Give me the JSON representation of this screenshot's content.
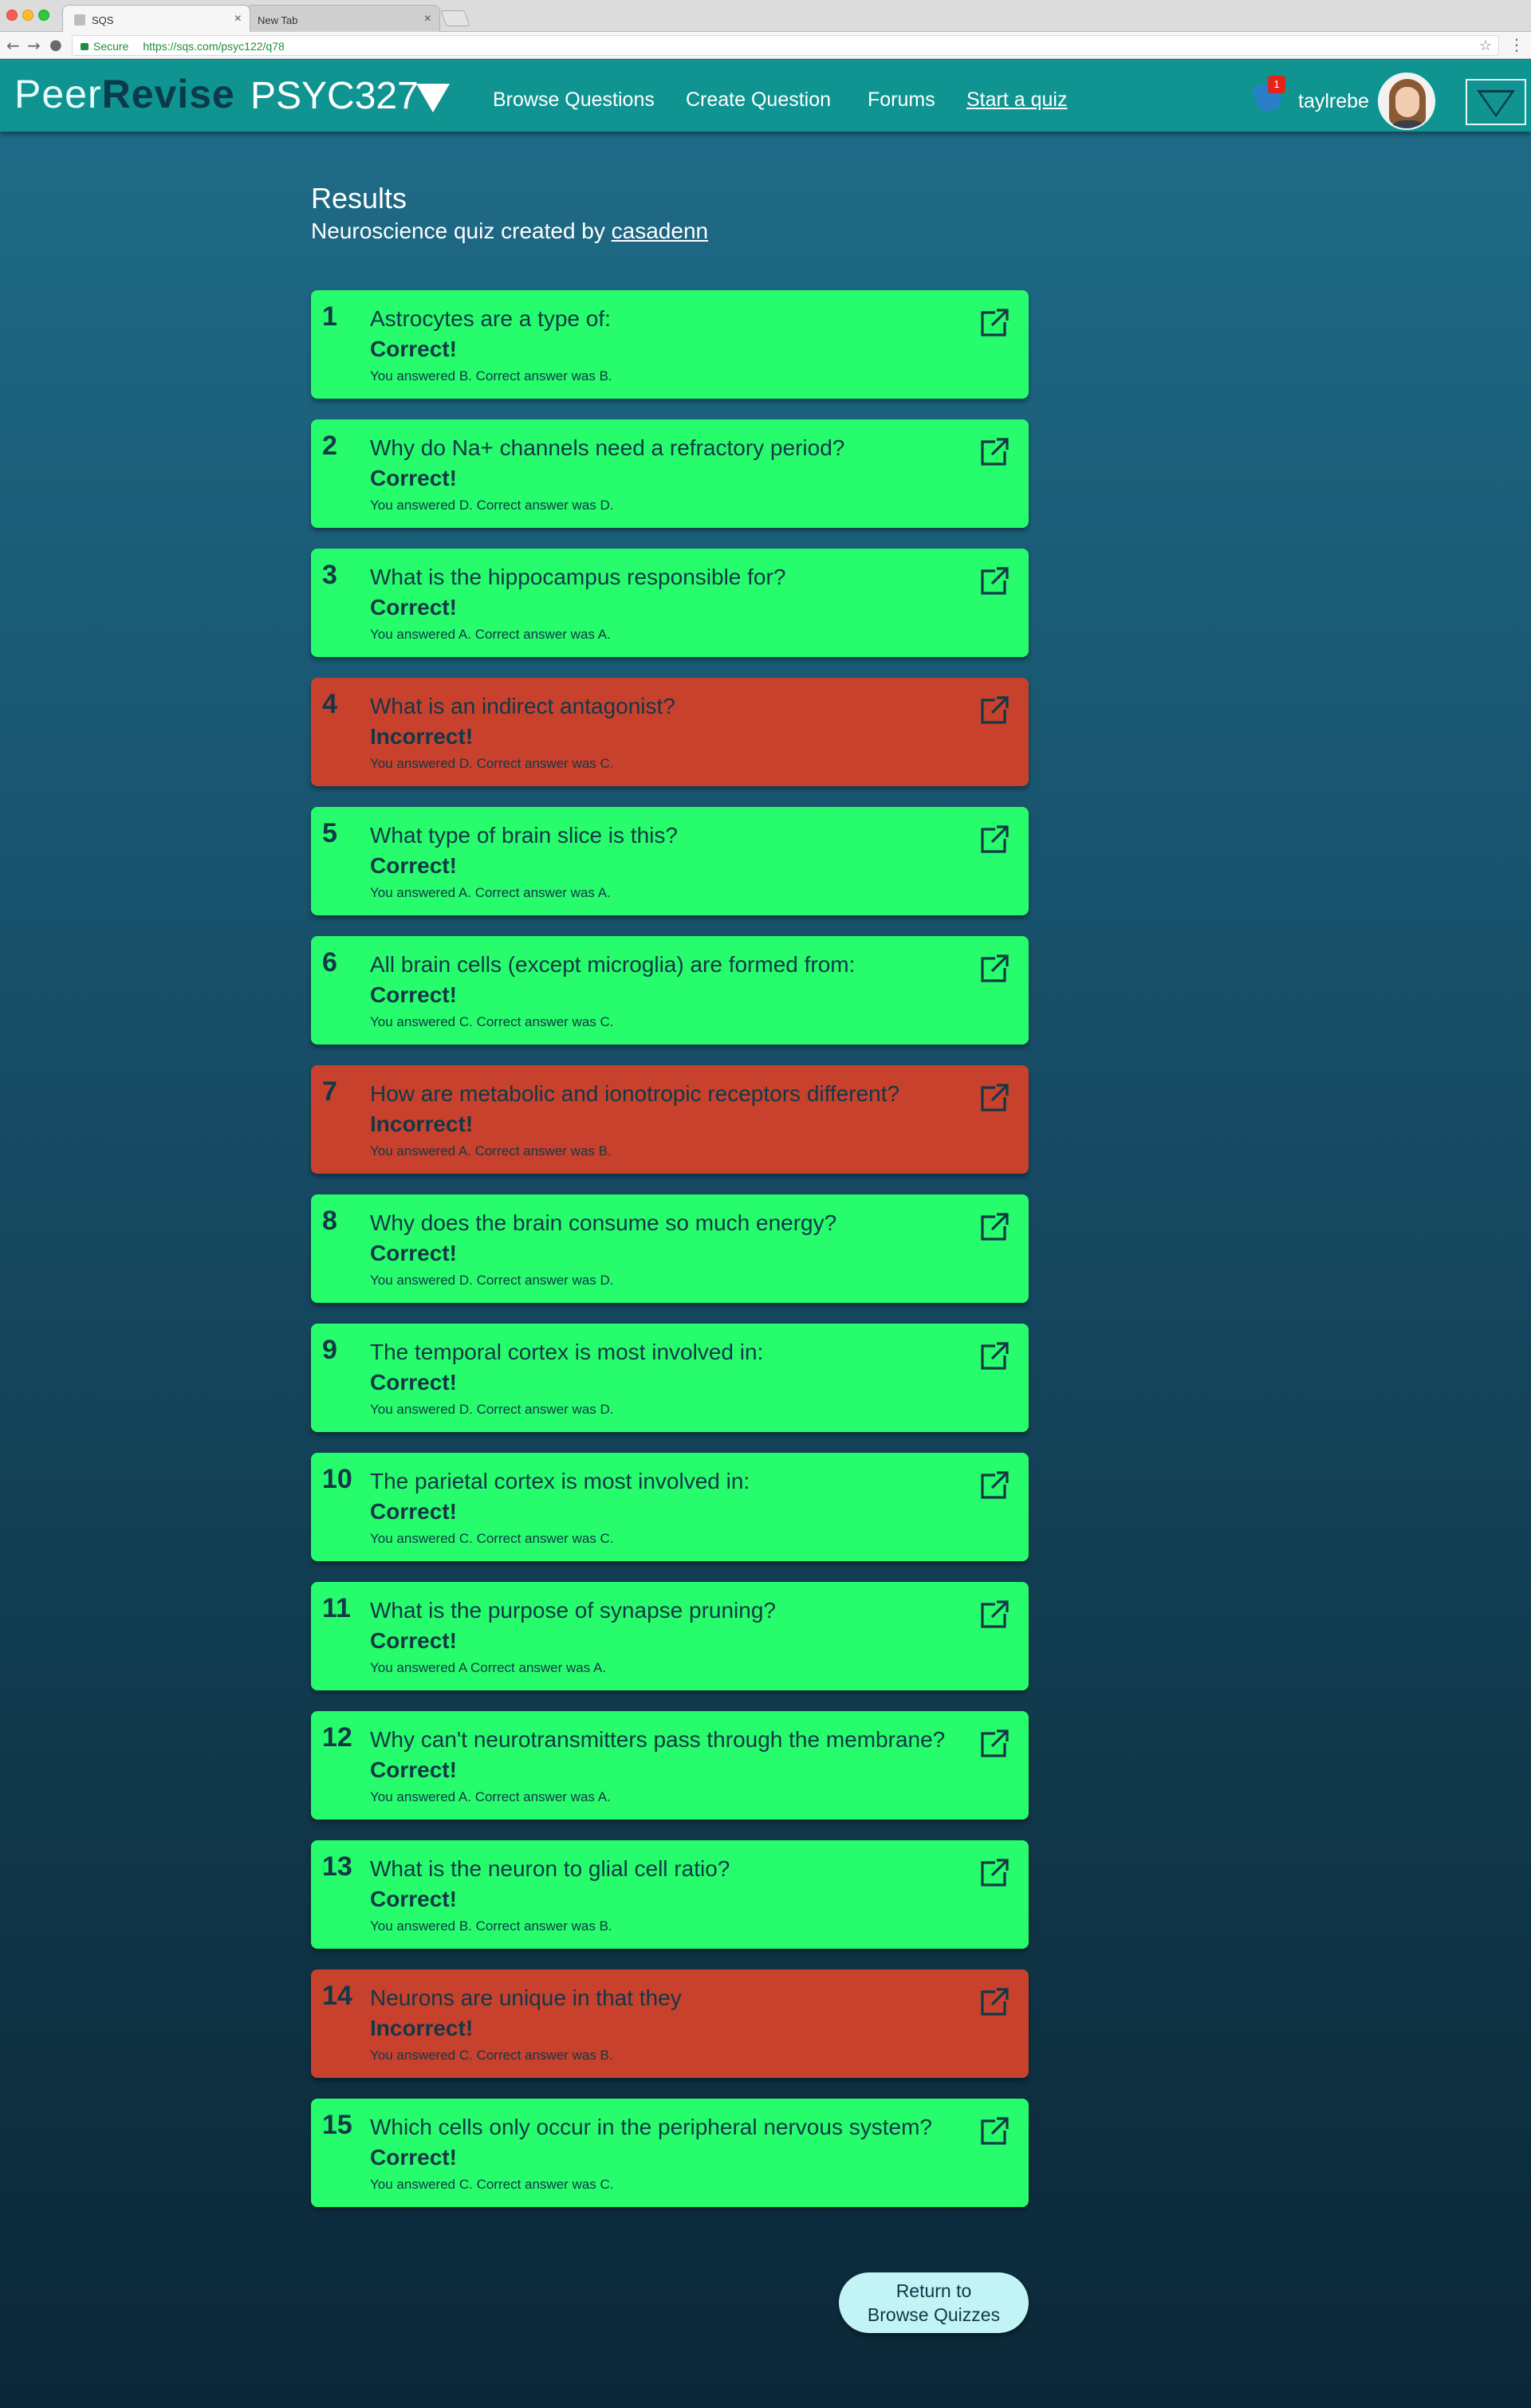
{
  "browser": {
    "tabs": [
      {
        "label": "SQS",
        "active": true
      },
      {
        "label": "New Tab",
        "active": false
      }
    ],
    "secure_label": "Secure",
    "url": "https://sqs.com/psyc122/q78"
  },
  "nav": {
    "brand_peer": "Peer",
    "brand_revise": "Revise",
    "course": "PSYC327",
    "links": [
      "Browse Questions",
      "Create Question",
      "Forums",
      "Start a quiz"
    ],
    "notification_count": "1",
    "username": "taylrebe"
  },
  "results": {
    "title": "Results",
    "subtitle_prefix": "Neuroscience quiz created by",
    "author": "casadenn"
  },
  "questions": [
    {
      "num": "1",
      "question": "Astrocytes are a type of:",
      "verdict": "Correct!",
      "detail": "You answered B. Correct answer was B.",
      "status": "correct"
    },
    {
      "num": "2",
      "question": "Why do Na+ channels need a refractory period?",
      "verdict": "Correct!",
      "detail": "You answered D. Correct answer was D.",
      "status": "correct"
    },
    {
      "num": "3",
      "question": "What is the hippocampus responsible for?",
      "verdict": "Correct!",
      "detail": "You answered A. Correct answer was A.",
      "status": "correct"
    },
    {
      "num": "4",
      "question": "What is an indirect antagonist?",
      "verdict": "Incorrect!",
      "detail": "You answered D. Correct answer was C.",
      "status": "incorrect"
    },
    {
      "num": "5",
      "question": "What type of brain slice is this?",
      "verdict": "Correct!",
      "detail": "You answered A. Correct answer was A.",
      "status": "correct"
    },
    {
      "num": "6",
      "question": "All brain cells (except microglia) are formed from:",
      "verdict": "Correct!",
      "detail": "You answered C. Correct answer was C.",
      "status": "correct"
    },
    {
      "num": "7",
      "question": "How are metabolic and ionotropic receptors different?",
      "verdict": "Incorrect!",
      "detail": "You answered A. Correct answer was B.",
      "status": "incorrect"
    },
    {
      "num": "8",
      "question": "Why does the brain consume so much energy?",
      "verdict": "Correct!",
      "detail": "You answered D. Correct answer was D.",
      "status": "correct"
    },
    {
      "num": "9",
      "question": "The temporal cortex is most involved in:",
      "verdict": "Correct!",
      "detail": "You answered D. Correct answer was D.",
      "status": "correct"
    },
    {
      "num": "10",
      "question": "The parietal cortex is most involved in:",
      "verdict": "Correct!",
      "detail": "You answered C. Correct answer was C.",
      "status": "correct"
    },
    {
      "num": "11",
      "question": "What is the purpose of synapse pruning?",
      "verdict": "Correct!",
      "detail": "You answered A Correct answer was A.",
      "status": "correct"
    },
    {
      "num": "12",
      "question": "Why can't neurotransmitters pass through the membrane?",
      "verdict": "Correct!",
      "detail": "You answered A. Correct answer was A.",
      "status": "correct"
    },
    {
      "num": "13",
      "question": "What is the neuron to glial cell ratio?",
      "verdict": "Correct!",
      "detail": "You answered B. Correct answer was B.",
      "status": "correct"
    },
    {
      "num": "14",
      "question": "Neurons are unique in that they",
      "verdict": "Incorrect!",
      "detail": "You answered C. Correct answer was B.",
      "status": "incorrect"
    },
    {
      "num": "15",
      "question": "Which cells only occur in the peripheral nervous system?",
      "verdict": "Correct!",
      "detail": "You answered C. Correct answer was C.",
      "status": "correct"
    }
  ],
  "return_button": {
    "line1": "Return to",
    "line2": "Browse Quizzes"
  },
  "colors": {
    "correct": "#27fc6c",
    "incorrect": "#c7412d",
    "navbar": "#0f9492"
  },
  "icons": {
    "open_external": "external-link-icon",
    "notification": "notification-icon"
  }
}
